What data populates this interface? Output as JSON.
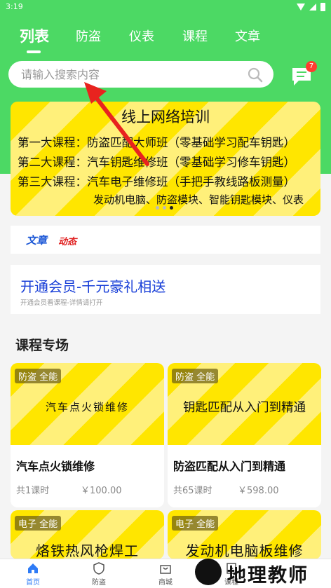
{
  "status_bar": {
    "time": "3:19",
    "icons": [
      "wifi-icon",
      "signal-icon",
      "battery-icon"
    ]
  },
  "colors": {
    "brand_green": "#4cd964",
    "banner_yellow": "#ffe600",
    "link_blue": "#1a40d8",
    "badge_red": "#ff3b30",
    "nav_active": "#2e7bf6"
  },
  "tabs": [
    {
      "label": "列表",
      "active": true
    },
    {
      "label": "防盗",
      "active": false
    },
    {
      "label": "仪表",
      "active": false
    },
    {
      "label": "课程",
      "active": false
    },
    {
      "label": "文章",
      "active": false
    }
  ],
  "search": {
    "placeholder": "请输入搜索内容",
    "value": "",
    "icon": "search-icon"
  },
  "messages": {
    "icon": "message-icon",
    "badge_count": "7"
  },
  "banner": {
    "title": "线上网络培训",
    "lines": [
      "第一大课程：防盗匹配大师班（零基础学习配车钥匙）",
      "第二大课程：汽车钥匙维修班（零基础学习修车钥匙）",
      "第三大课程：汽车电子维修班（手把手教线路板测量）",
      "发动机电脑、防盗模块、智能钥匙模块、仪表"
    ],
    "slide_count": 3,
    "active_slide": 3
  },
  "news": {
    "word_a": "文章",
    "word_b": "动态"
  },
  "member": {
    "title": "开通会员-千元豪礼相送",
    "subtitle": "开通会员看课程-详情请打开"
  },
  "courses_section": {
    "title": "课程专场",
    "cards": [
      {
        "tag": "防盗 全能",
        "thumb_text": "汽车点火锁维修",
        "name": "汽车点火锁维修",
        "lessons": "共1课时",
        "price": "￥100.00"
      },
      {
        "tag": "防盗 全能",
        "thumb_text": "钥匙匹配从入门到精通",
        "name": "防盗匹配从入门到精通",
        "lessons": "共65课时",
        "price": "￥598.00"
      },
      {
        "tag": "电子 全能",
        "thumb_text": "烙铁热风枪焊工"
      },
      {
        "tag": "电子 全能",
        "thumb_text": "发动机电脑板维修"
      }
    ]
  },
  "bottom_nav": [
    {
      "label": "首页",
      "icon": "home-icon",
      "active": true
    },
    {
      "label": "防盗",
      "icon": "shield-icon",
      "active": false
    },
    {
      "label": "商城",
      "icon": "shop-icon",
      "active": false
    },
    {
      "label": "课程",
      "icon": "course-icon",
      "active": false
    }
  ],
  "watermark": {
    "text": "地理教师"
  }
}
